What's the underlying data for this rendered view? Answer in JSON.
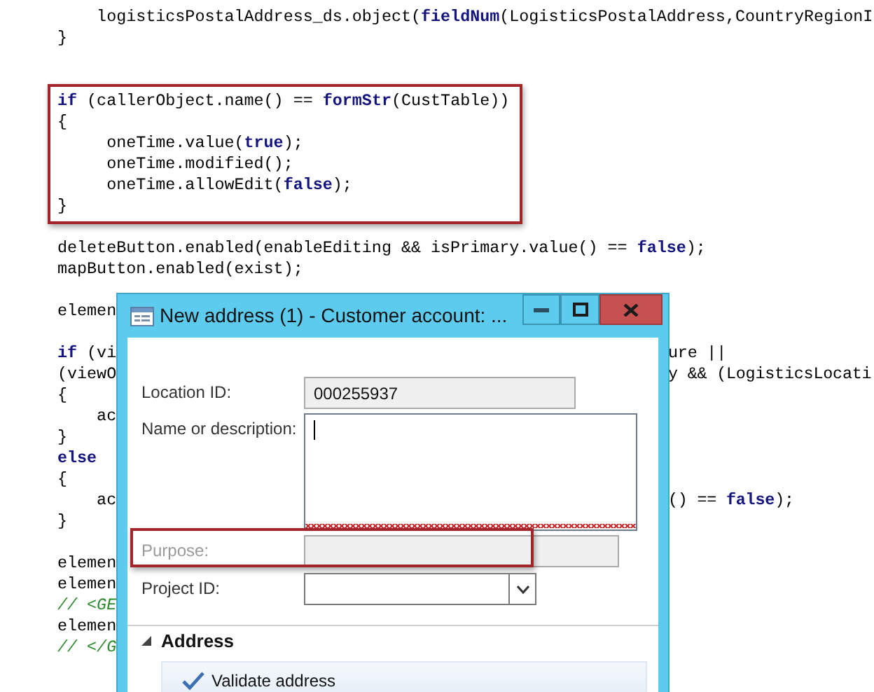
{
  "code": {
    "lines": [
      {
        "kind": "code",
        "left": [
          {
            "text": "    logisticsPostalAddress_ds.object(",
            "kind": "plain"
          },
          {
            "text": "fieldNum",
            "kind": "keyword"
          },
          {
            "text": "(LogisticsPostalAddress,CountryRegionI",
            "kind": "plain"
          }
        ]
      },
      {
        "kind": "code",
        "left": [
          {
            "text": "}",
            "kind": "plain"
          }
        ]
      },
      {
        "kind": "blank"
      },
      {
        "kind": "blank"
      },
      {
        "kind": "code",
        "highlighted": true,
        "left": [
          {
            "text": "if",
            "kind": "keyword"
          },
          {
            "text": " (callerObject.name() == ",
            "kind": "plain"
          },
          {
            "text": "formStr",
            "kind": "keyword"
          },
          {
            "text": "(CustTable))",
            "kind": "plain"
          }
        ]
      },
      {
        "kind": "code",
        "highlighted": true,
        "left": [
          {
            "text": "{",
            "kind": "plain"
          }
        ]
      },
      {
        "kind": "code",
        "highlighted": true,
        "left": [
          {
            "text": "     oneTime.value(",
            "kind": "plain"
          },
          {
            "text": "true",
            "kind": "keyword"
          },
          {
            "text": ");",
            "kind": "plain"
          }
        ]
      },
      {
        "kind": "code",
        "highlighted": true,
        "left": [
          {
            "text": "     oneTime.modified();",
            "kind": "plain"
          }
        ]
      },
      {
        "kind": "code",
        "highlighted": true,
        "left": [
          {
            "text": "     oneTime.allowEdit(",
            "kind": "plain"
          },
          {
            "text": "false",
            "kind": "keyword"
          },
          {
            "text": ");",
            "kind": "plain"
          }
        ]
      },
      {
        "kind": "code",
        "highlighted": true,
        "left": [
          {
            "text": "}",
            "kind": "plain"
          }
        ]
      },
      {
        "kind": "blank"
      },
      {
        "kind": "code",
        "left": [
          {
            "text": "deleteButton.enabled(enableEditing && isPrimary.value() == ",
            "kind": "plain"
          },
          {
            "text": "false",
            "kind": "keyword"
          },
          {
            "text": ");",
            "kind": "plain"
          }
        ]
      },
      {
        "kind": "code",
        "left": [
          {
            "text": "mapButton.enabled(exist);",
            "kind": "plain"
          }
        ]
      },
      {
        "kind": "blank"
      },
      {
        "kind": "code",
        "left": [
          {
            "text": "elemen",
            "kind": "plain"
          }
        ]
      },
      {
        "kind": "blank"
      },
      {
        "kind": "code",
        "left": [
          {
            "text": "if",
            "kind": "keyword"
          },
          {
            "text": " (vi",
            "kind": "plain"
          }
        ],
        "right": [
          {
            "text": "ure ||",
            "kind": "plain"
          }
        ]
      },
      {
        "kind": "code",
        "left": [
          {
            "text": "(viewO",
            "kind": "plain"
          }
        ],
        "right": [
          {
            "text": "y && (LogisticsLocati",
            "kind": "plain"
          }
        ]
      },
      {
        "kind": "code",
        "left": [
          {
            "text": "{",
            "kind": "plain"
          }
        ]
      },
      {
        "kind": "code",
        "left": [
          {
            "text": "    ac",
            "kind": "plain"
          }
        ]
      },
      {
        "kind": "code",
        "left": [
          {
            "text": "}",
            "kind": "plain"
          }
        ]
      },
      {
        "kind": "code",
        "left": [
          {
            "text": "else",
            "kind": "keyword"
          }
        ]
      },
      {
        "kind": "code",
        "left": [
          {
            "text": "{",
            "kind": "plain"
          }
        ]
      },
      {
        "kind": "code",
        "left": [
          {
            "text": "    ac",
            "kind": "plain"
          }
        ],
        "right": [
          {
            "text": "() == ",
            "kind": "plain"
          },
          {
            "text": "false",
            "kind": "keyword"
          },
          {
            "text": ");",
            "kind": "plain"
          }
        ]
      },
      {
        "kind": "code",
        "left": [
          {
            "text": "}",
            "kind": "plain"
          }
        ]
      },
      {
        "kind": "blank"
      },
      {
        "kind": "code",
        "left": [
          {
            "text": "elemen",
            "kind": "plain"
          }
        ]
      },
      {
        "kind": "code",
        "left": [
          {
            "text": "elemen",
            "kind": "plain"
          }
        ]
      },
      {
        "kind": "code",
        "left": [
          {
            "text": "// <GE",
            "kind": "comment"
          }
        ]
      },
      {
        "kind": "code",
        "left": [
          {
            "text": "elemen",
            "kind": "plain"
          }
        ]
      },
      {
        "kind": "code",
        "left": [
          {
            "text": "// </G",
            "kind": "comment"
          }
        ]
      }
    ]
  },
  "dialog": {
    "title": "New address (1) - Customer account: ...",
    "fields": [
      {
        "kind": "text",
        "label": "Location ID:",
        "value": "000255937",
        "readonly": true,
        "disabled": false
      },
      {
        "kind": "textarea",
        "label": "Name or description:",
        "focused": true,
        "spelling_error": true,
        "readonly": false,
        "disabled": false
      },
      {
        "kind": "text",
        "label": "Purpose:",
        "readonly": true,
        "disabled": true,
        "highlighted": true
      },
      {
        "kind": "combo",
        "label": "Project ID:",
        "readonly": false,
        "disabled": false
      }
    ],
    "section": {
      "title": "Address",
      "expanded": true
    },
    "actions": [
      {
        "label": "Validate address"
      }
    ]
  }
}
